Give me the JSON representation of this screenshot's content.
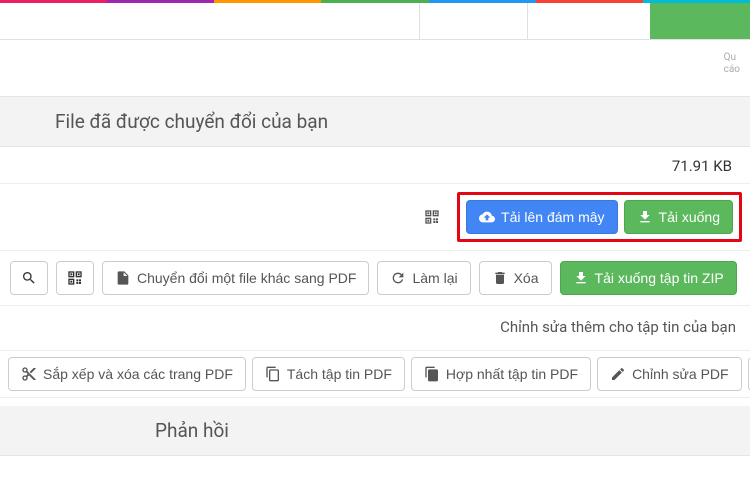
{
  "rainbow_colors": [
    "#e91e63",
    "#9c27b0",
    "#ff9800",
    "#4caf50",
    "#2196f3",
    "#f44336",
    "#00bcd4"
  ],
  "sidebar_ad": {
    "line1": "Qu",
    "line2": "cáo"
  },
  "header": {
    "title": "File đã được chuyển đổi của bạn"
  },
  "file": {
    "size": "71.91 KB"
  },
  "primary_actions": {
    "upload_cloud": "Tải lên đám mây",
    "download": "Tải xuống"
  },
  "toolbar": {
    "convert_another": "Chuyển đổi một file khác sang PDF",
    "redo": "Làm lại",
    "delete": "Xóa",
    "download_zip": "Tải xuống tập tin ZIP"
  },
  "subtext": "Chỉnh sửa thêm cho tập tin của bạn",
  "edit_tools": {
    "sort_delete": "Sắp xếp và xóa các trang PDF",
    "split": "Tách tập tin PDF",
    "merge": "Hợp nhất tập tin PDF",
    "edit": "Chỉnh sửa PDF",
    "more": "•••"
  },
  "feedback": {
    "title": "Phản hồi"
  }
}
